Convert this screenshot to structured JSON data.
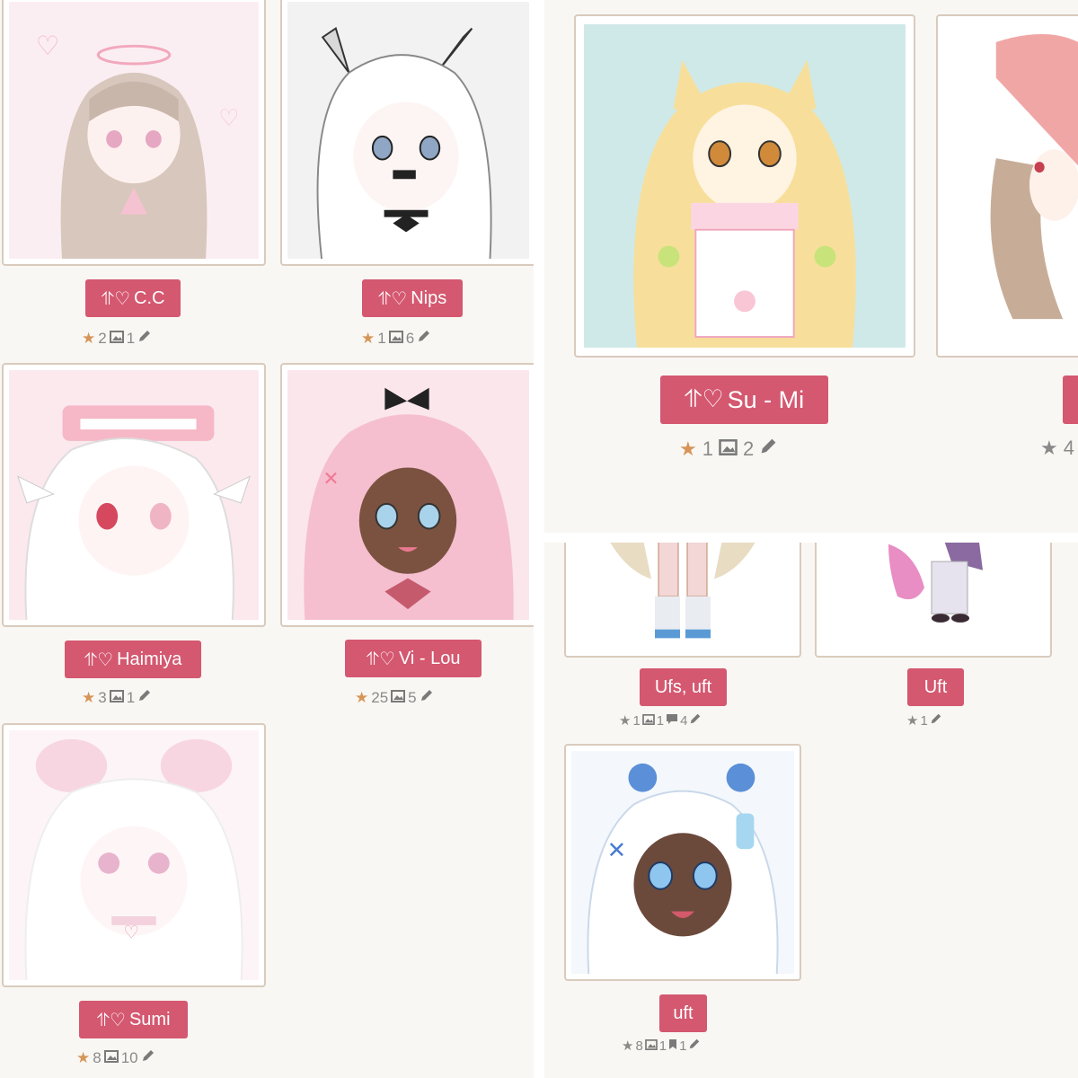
{
  "mark": "⥣♡",
  "pencil_icon": "pencil-icon",
  "star_icon": "star-icon",
  "image_icon": "image-icon",
  "comment_icon": "comment-icon",
  "bookmark_icon": "bookmark-icon",
  "colors": {
    "button": "#d45870",
    "button_text": "#ffffff",
    "star": "#d69558",
    "stat_text": "#8a8a8a",
    "card_border": "#d9cbbd",
    "panel_bg": "#f9f7f3"
  },
  "left_panel": {
    "cards": [
      {
        "name": "C.C",
        "stars": "2",
        "images": "1"
      },
      {
        "name": "Nips",
        "stars": "1",
        "images": "6"
      },
      {
        "name": "Haimiya",
        "stars": "3",
        "images": "1"
      },
      {
        "name": "Vi - Lou",
        "stars": "25",
        "images": "5"
      },
      {
        "name": "Sumi",
        "stars": "8",
        "images": "10"
      }
    ]
  },
  "top_right_panel": {
    "cards": [
      {
        "name": "Su - Mi",
        "stars": "1",
        "images": "2"
      }
    ],
    "partial_stat": "4"
  },
  "bottom_right_panel": {
    "cards": [
      {
        "name": "Ufs, uft",
        "stars": "1",
        "images": "1",
        "comments": "4"
      },
      {
        "name": "Uft",
        "stars": "1"
      },
      {
        "name": "uft",
        "stars": "8",
        "images": "1",
        "bookmarks": "1"
      }
    ]
  }
}
